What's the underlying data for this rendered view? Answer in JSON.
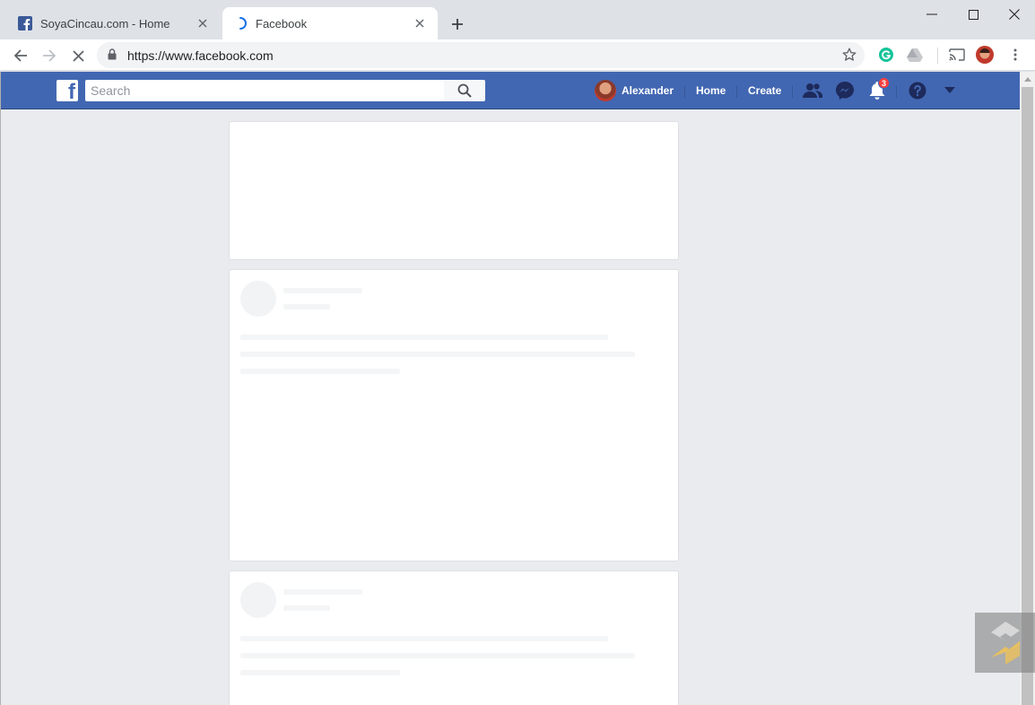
{
  "browser": {
    "tabs": [
      {
        "title": "SoyaCincau.com - Home",
        "favicon": "facebook-f-icon",
        "active": false
      },
      {
        "title": "Facebook",
        "favicon": "loading-spinner-icon",
        "active": true
      }
    ],
    "address_bar": {
      "url": "https://www.facebook.com"
    },
    "extensions": [
      "grammarly-icon",
      "google-drive-icon",
      "cast-icon"
    ],
    "loading": true
  },
  "facebook": {
    "search": {
      "placeholder": "Search"
    },
    "nav": {
      "profile_name": "Alexander",
      "home_label": "Home",
      "create_label": "Create"
    },
    "notifications": {
      "count": "3"
    },
    "colors": {
      "bar": "#4267b2",
      "background": "#e9ebee",
      "badge": "#fa3e3e"
    }
  },
  "feed": {
    "state": "loading placeholders"
  }
}
